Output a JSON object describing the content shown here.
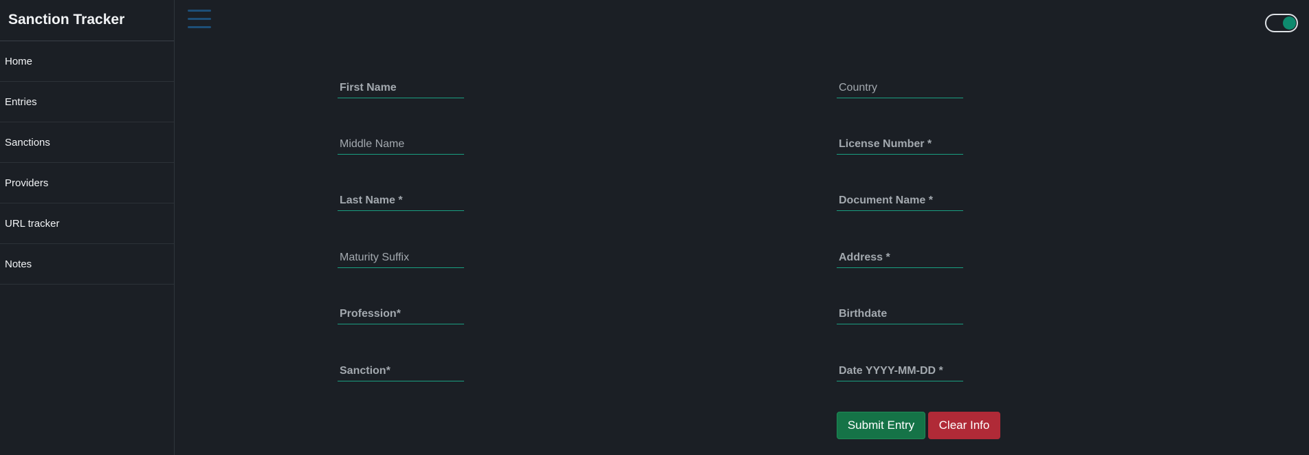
{
  "app": {
    "title": "Sanction Tracker"
  },
  "sidebar": {
    "items": [
      {
        "label": "Home"
      },
      {
        "label": "Entries"
      },
      {
        "label": "Sanctions"
      },
      {
        "label": "Providers"
      },
      {
        "label": "URL tracker"
      },
      {
        "label": "Notes"
      }
    ]
  },
  "topbar": {
    "menu_icon": "hamburger-menu-icon",
    "theme_toggle": {
      "state": "on",
      "color": "#0e8a6e"
    }
  },
  "form": {
    "left": [
      {
        "placeholder": "First Name",
        "value": ""
      },
      {
        "placeholder": "Middle Name",
        "value": ""
      },
      {
        "placeholder": "Last Name *",
        "value": ""
      },
      {
        "placeholder": "Maturity Suffix",
        "value": ""
      },
      {
        "placeholder": "Profession*",
        "value": ""
      },
      {
        "placeholder": "Sanction*",
        "value": ""
      }
    ],
    "right": [
      {
        "placeholder": "Country",
        "value": ""
      },
      {
        "placeholder": "License Number *",
        "value": ""
      },
      {
        "placeholder": "Document Name *",
        "value": ""
      },
      {
        "placeholder": "Address *",
        "value": ""
      },
      {
        "placeholder": "Birthdate",
        "value": ""
      },
      {
        "placeholder": "Date YYYY-MM-DD *",
        "value": ""
      }
    ],
    "submit_label": "Submit Entry",
    "clear_label": "Clear Info"
  },
  "colors": {
    "background": "#1b1f25",
    "accent_underline": "#1aa082",
    "submit": "#157347",
    "clear": "#b02a37",
    "menu_icon": "#1d4f78"
  }
}
